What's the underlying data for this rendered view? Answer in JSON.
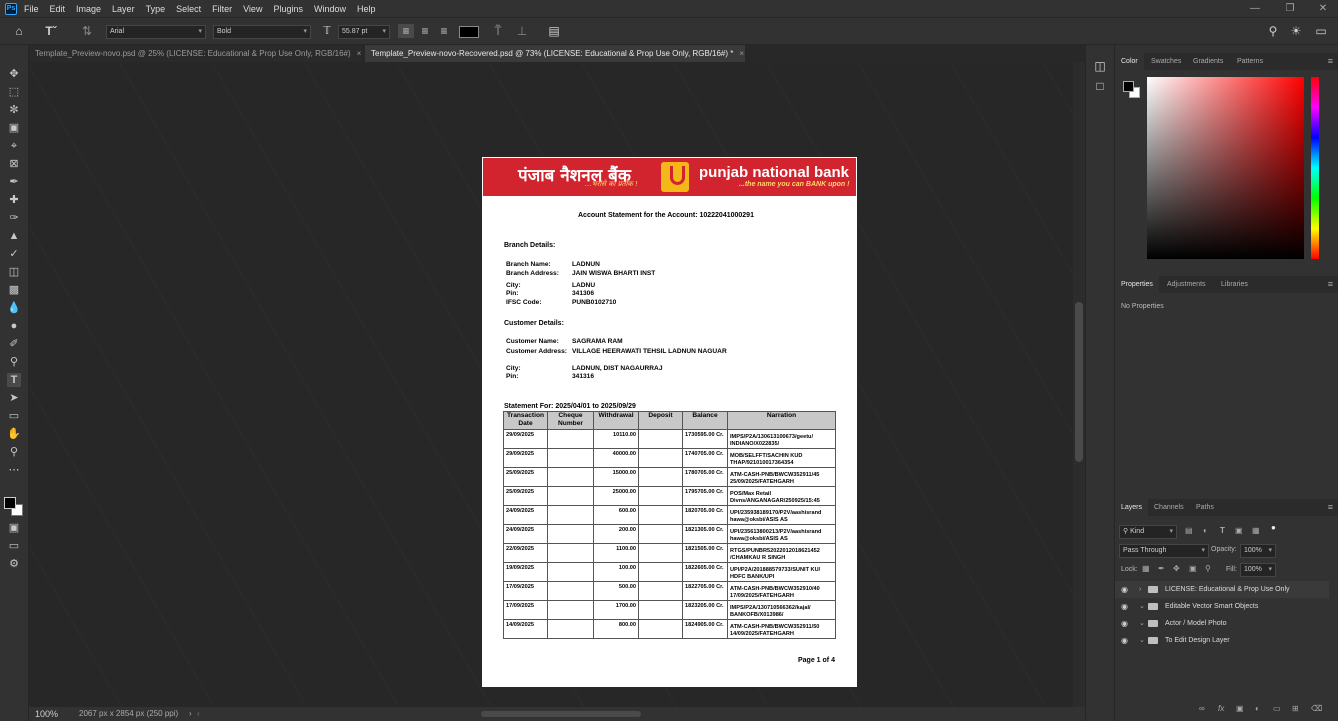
{
  "menu": [
    "File",
    "Edit",
    "Image",
    "Layer",
    "Type",
    "Select",
    "Filter",
    "View",
    "Plugins",
    "Window",
    "Help"
  ],
  "options": {
    "font_family": "Arial",
    "font_style": "Bold",
    "font_size": "55.87 pt",
    "text_color": "#000000"
  },
  "tabs": [
    {
      "label": "Template_Preview-novo.psd @ 25% (LICENSE: Educational & Prop Use Only, RGB/16#)",
      "active": false
    },
    {
      "label": "Template_Preview-novo-Recovered.psd @ 73% (LICENSE: Educational & Prop Use Only, RGB/16#) *",
      "active": true
    }
  ],
  "status": {
    "zoom": "100%",
    "doc_info": "2067 px x 2854 px (250 ppi)"
  },
  "document": {
    "bank_hindi": "पंजाब नैशनल बैंक",
    "bank_hindi_tag": "...भरोसे का प्रतीक !",
    "bank_english": "punjab national bank",
    "bank_english_tag": "...the name you can BANK upon !",
    "title": "Account Statement for the Account: 10222041000291",
    "branch_heading": "Branch Details:",
    "branch": [
      {
        "label": "Branch Name:",
        "value": "LADNUN"
      },
      {
        "label": "Branch Address:",
        "value": "JAIN WISWA BHARTI INST"
      },
      {
        "label": "City:",
        "value": "LADNU"
      },
      {
        "label": "Pin:",
        "value": "341306"
      },
      {
        "label": "IFSC Code:",
        "value": "PUNB0102710"
      }
    ],
    "customer_heading": "Customer Details:",
    "customer": [
      {
        "label": "Customer Name:",
        "value": "SAGRAMA RAM"
      },
      {
        "label": "Customer Address:",
        "value": "VILLAGE HEERAWATI TEHSIL LADNUN NAGUAR"
      },
      {
        "label": "City:",
        "value": "LADNUN, DIST NAGAURRAJ"
      },
      {
        "label": "Pin:",
        "value": "341316"
      }
    ],
    "period": "Statement For: 2025/04/01 to 2025/09/29",
    "columns": [
      "Transaction Date",
      "Cheque Number",
      "Withdrawal",
      "Deposit",
      "Balance",
      "Narration"
    ],
    "rows": [
      [
        "29/09/2025",
        "",
        "10110.00",
        "",
        "1730595.00 Cr.",
        "IMPS/P2A/130613100673/geetu/ INDIANO/X022835/"
      ],
      [
        "29/09/2025",
        "",
        "40000.00",
        "",
        "1740705.00 Cr.",
        "MOB/SELFFT/SACHIN KUD THAP/921010017364354"
      ],
      [
        "25/09/2025",
        "",
        "15000.00",
        "",
        "1780705.00 Cr.",
        "ATM-CASH-PNB/BWCW352911/45 25/09/2025/FATEHGARH"
      ],
      [
        "25/09/2025",
        "",
        "25000.00",
        "",
        "1795705.00 Cr.",
        "POS/Max Retail Divns/ANGANAGAR/250925/15:45"
      ],
      [
        "24/09/2025",
        "",
        "600.00",
        "",
        "1820705.00 Cr.",
        "UPI/235938189170/P2V/aashisrand hawa@oksbi/ASIS AS"
      ],
      [
        "24/09/2025",
        "",
        "200.00",
        "",
        "1821305.00 Cr.",
        "UPI/235613800213/P2V/aashisrand hawa@oksbi/ASIS AS"
      ],
      [
        "22/09/2025",
        "",
        "1100.00",
        "",
        "1821505.00 Cr.",
        "RTGS/PUNBR52022012018621452 /CHAMKAU R SINGH"
      ],
      [
        "19/09/2025",
        "",
        "100.00",
        "",
        "1822605.00 Cr.",
        "UPI/P2A/201888579733/SUNIT KU/ HDFC BANK/UPI"
      ],
      [
        "17/09/2025",
        "",
        "500.00",
        "",
        "1822705.00 Cr.",
        "ATM-CASH-PNB/BWCW352910/40 17/09/2025/FATEHGARH"
      ],
      [
        "17/09/2025",
        "",
        "1700.00",
        "",
        "1823205.00 Cr.",
        "IMPS/P2A/130710566362/kajal/ BANKOFB/X013986/"
      ],
      [
        "14/09/2025",
        "",
        "800.00",
        "",
        "1824905.00 Cr.",
        "ATM-CASH-PNB/BWCW352911/50 14/09/2025/FATEHGARH"
      ]
    ],
    "page_number": "Page 1 of 4"
  },
  "panels": {
    "color_tabs": [
      "Color",
      "Swatches",
      "Gradients",
      "Patterns"
    ],
    "properties_tabs": [
      "Properties",
      "Adjustments",
      "Libraries"
    ],
    "properties_empty": "No Properties",
    "layers_tabs": [
      "Layers",
      "Channels",
      "Paths"
    ],
    "kind_label": "Kind",
    "blend_mode": "Pass Through",
    "opacity_label": "Opacity:",
    "opacity": "100%",
    "lock_label": "Lock:",
    "fill_label": "Fill:",
    "fill": "100%",
    "layers": [
      "LICENSE: Educational & Prop Use Only",
      "Editable Vector Smart Objects",
      "Actor / Model Photo",
      "To Edit Design Layer"
    ]
  }
}
